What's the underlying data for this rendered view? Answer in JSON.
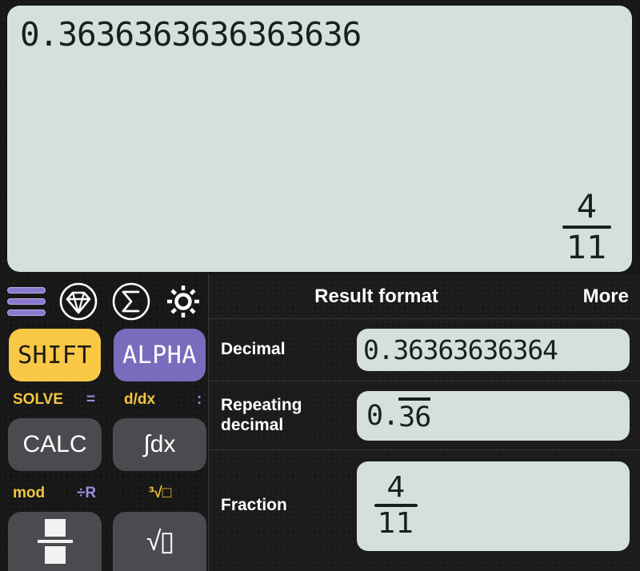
{
  "display": {
    "main_value": "0.3636363636363636",
    "fraction_numerator": "4",
    "fraction_denominator": "11"
  },
  "toolbar": {
    "items": [
      {
        "icon": "hamburger-menu-icon",
        "name": "menu"
      },
      {
        "icon": "gem-icon",
        "name": "gem"
      },
      {
        "icon": "sigma-icon",
        "name": "sigma"
      },
      {
        "icon": "gear-icon",
        "name": "settings"
      }
    ]
  },
  "keypad": {
    "shift_label": "SHIFT",
    "alpha_label": "ALPHA",
    "secondary_labels_row1": [
      {
        "text": "SOLVE",
        "color": "#f4c542"
      },
      {
        "text": "=",
        "color": "#9b8ede"
      },
      {
        "text": "d/dx",
        "color": "#f4c542"
      },
      {
        "text": ":",
        "color": "#9b8ede"
      }
    ],
    "calc_label": "CALC",
    "integral_label": "∫dx",
    "secondary_labels_row2": [
      {
        "text": "mod",
        "color": "#f4c542"
      },
      {
        "text": "÷R",
        "color": "#9b8ede"
      },
      {
        "text": "³√□",
        "color": "#f4c542"
      }
    ],
    "fraction_key_label": "",
    "sqrt_key_label": "√▯"
  },
  "panel": {
    "title": "Result format",
    "more_label": "More",
    "rows": [
      {
        "label": "Decimal",
        "value": "0.36363636364",
        "type": "text"
      },
      {
        "label": "Repeating decimal",
        "value_whole": "0.",
        "value_repeat": "36",
        "type": "repeating"
      },
      {
        "label": "Fraction",
        "numerator": "4",
        "denominator": "11",
        "type": "fraction"
      }
    ]
  },
  "colors": {
    "display_bg": "#d4e0de",
    "shift_key": "#f8c846",
    "alpha_key": "#7a6cbd",
    "accent_yellow": "#f4c542",
    "accent_purple": "#9b8ede",
    "key_dark": "#4b4b4f",
    "panel_bg": "#1b1b1b"
  }
}
